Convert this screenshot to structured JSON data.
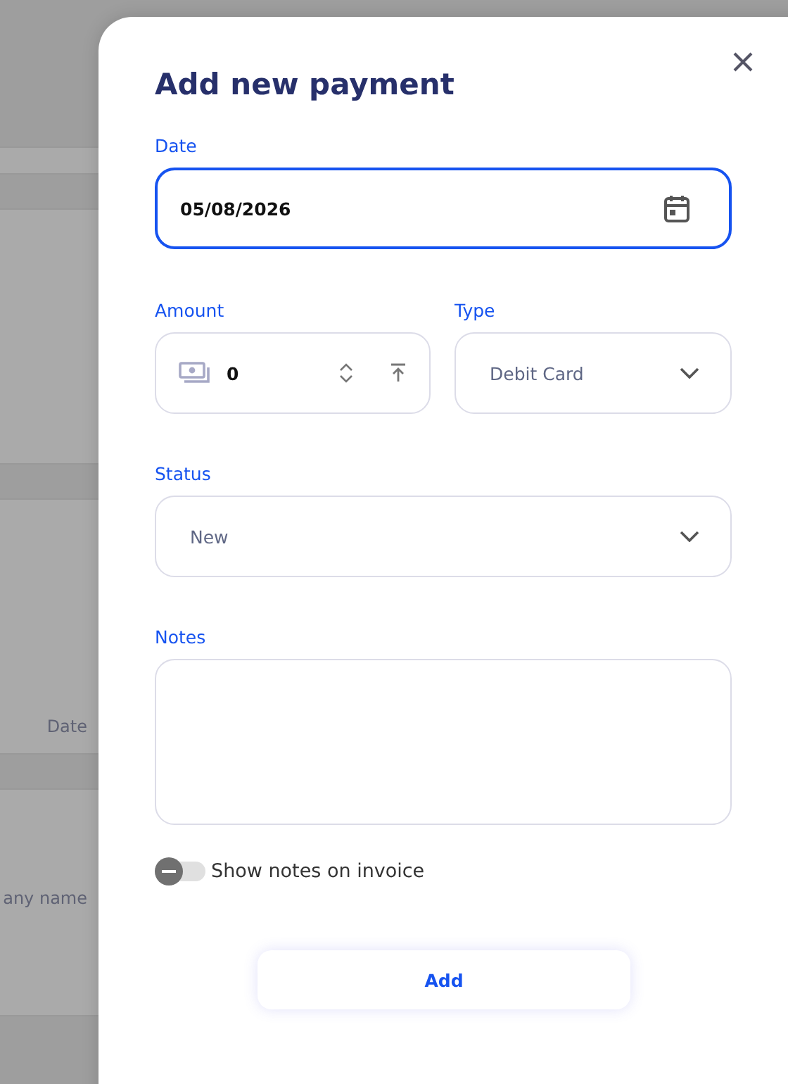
{
  "background": {
    "labels": [
      "Date",
      "any name"
    ]
  },
  "dialog": {
    "title": "Add new payment",
    "date": {
      "label": "Date",
      "value": "05/08/2026",
      "focused": true
    },
    "amount": {
      "label": "Amount",
      "value": "0",
      "focused": false
    },
    "type": {
      "label": "Type",
      "value": "Debit Card",
      "focused": false
    },
    "status": {
      "label": "Status",
      "value": "New",
      "focused": false
    },
    "notes": {
      "label": "Notes",
      "focused": false
    },
    "toggle": {
      "label": "Show notes on invoice",
      "on": false
    },
    "buttons": [
      "Add"
    ]
  }
}
